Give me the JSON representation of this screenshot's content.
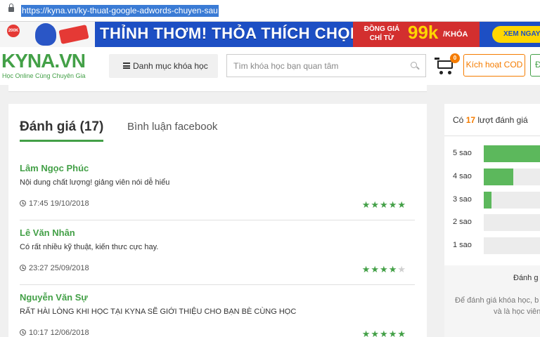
{
  "browser": {
    "url": "https://kyna.vn/ky-thuat-google-adwords-chuyen-sau"
  },
  "banner": {
    "badge": "200K",
    "headline": "THỈNH THƠM! THỎA THÍCH CHỌN",
    "price_prefix_line1": "ĐỒNG GIÁ",
    "price_prefix_line2": "CHỈ TỪ",
    "price": "99k",
    "price_unit": "/KHÓA",
    "cta": "XEM NGAY"
  },
  "header": {
    "logo_text": "KYNA",
    "logo_suffix": ".VN",
    "tagline": "Học Online Cùng Chuyên Gia",
    "category_button": "Danh mục khóa học",
    "search_placeholder": "Tìm khóa học bạn quan tâm",
    "cart_count": "0",
    "cod_button": "Kích hoạt COD",
    "extra_button": "Đ"
  },
  "reviews": {
    "tab_active": "Đánh giá (17)",
    "tab_other": "Bình luận facebook",
    "items": [
      {
        "name": "Lâm Ngọc Phúc",
        "comment": "Nội dung chất lượng! giảng viên nói dễ hiểu",
        "time": "17:45 19/10/2018",
        "rating": 5
      },
      {
        "name": "Lê Văn Nhân",
        "comment": "Có rất nhiều kỹ thuật, kiến thưc cực hay.",
        "time": "23:27 25/09/2018",
        "rating": 4
      },
      {
        "name": "Nguyễn Văn Sự",
        "comment": "RẤT HÀI LÒNG KHI HỌC TẠI KYNA SẼ GIỚI THIỆU CHO BẠN BÈ CÙNG HỌC",
        "time": "10:17 12/06/2018",
        "rating": 5
      }
    ]
  },
  "summary": {
    "count_prefix": "Có",
    "count": "17",
    "count_suffix": "lượt đánh giá",
    "distribution": [
      {
        "label": "5 sao",
        "fraction": 0.95
      },
      {
        "label": "4 sao",
        "fraction": 0.47
      },
      {
        "label": "3 sao",
        "fraction": 0.12
      },
      {
        "label": "2 sao",
        "fraction": 0
      },
      {
        "label": "1 sao",
        "fraction": 0
      }
    ],
    "rate_title": "Đánh g",
    "rate_desc_line1": "Để đánh giá khóa học, b",
    "rate_desc_line2": "và là học viên"
  },
  "colors": {
    "brand_green": "#43a047",
    "accent_orange": "#f57c00",
    "bar_green": "#5cb85c",
    "banner_blue": "#1d4fc4"
  }
}
